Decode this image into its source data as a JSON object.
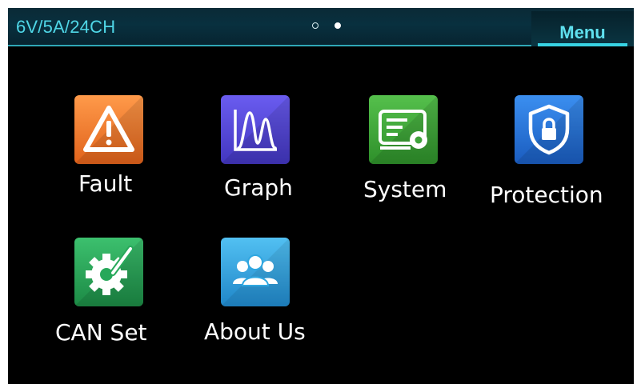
{
  "header": {
    "title": "6V/5A/24CH",
    "page_indicator": {
      "pages": 2,
      "current": 2
    },
    "menu_label": "Menu"
  },
  "tiles": [
    {
      "label": "Fault",
      "icon": "warning-triangle-icon",
      "color": "#f07d2f"
    },
    {
      "label": "Graph",
      "icon": "waveform-graph-icon",
      "color": "#5a4bd9"
    },
    {
      "label": "System",
      "icon": "system-settings-icon",
      "color": "#3fa33a"
    },
    {
      "label": "Protection",
      "icon": "shield-lock-icon",
      "color": "#2374d4"
    },
    {
      "label": "CAN Set",
      "icon": "gear-pencil-icon",
      "color": "#27a85a"
    },
    {
      "label": "About Us",
      "icon": "people-group-icon",
      "color": "#2fa7e0"
    }
  ],
  "colors": {
    "header_text": "#4fd6e6",
    "accent": "#38d3e3",
    "background": "#000000"
  }
}
